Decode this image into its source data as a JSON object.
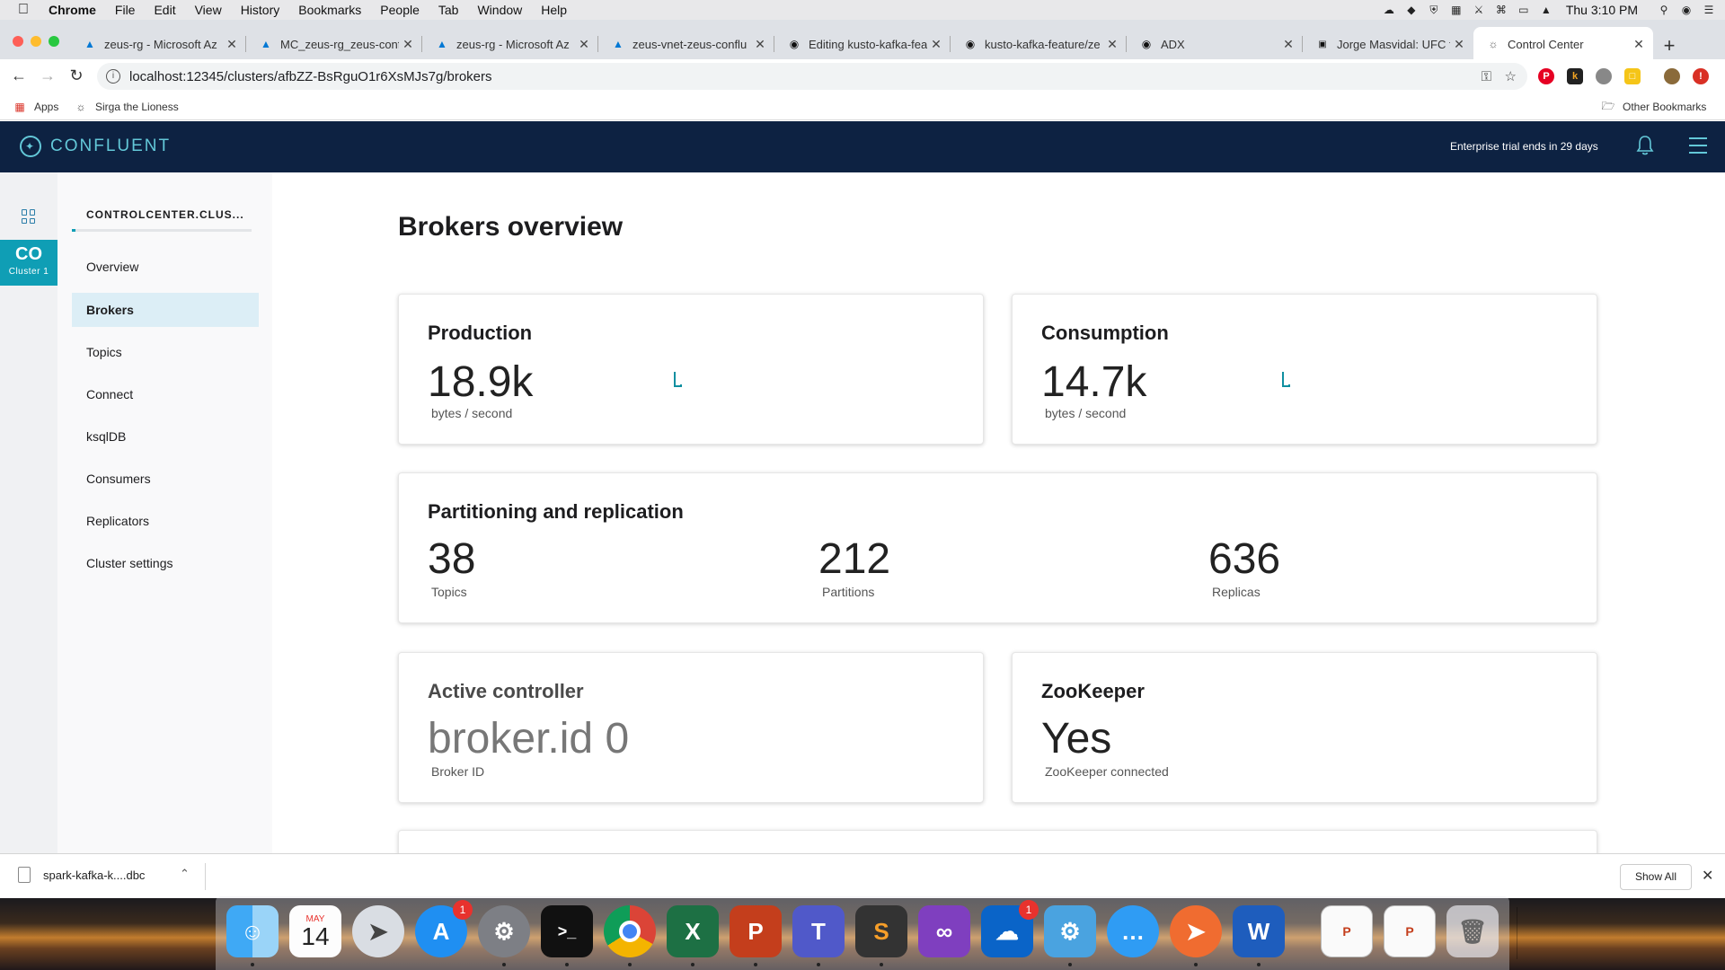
{
  "menubar": {
    "app": "Chrome",
    "items": [
      "File",
      "Edit",
      "View",
      "History",
      "Bookmarks",
      "People",
      "Tab",
      "Window",
      "Help"
    ],
    "clock": "Thu 3:10 PM"
  },
  "tabs": [
    {
      "title": "zeus-rg - Microsoft Az",
      "icon": "azure-icon"
    },
    {
      "title": "MC_zeus-rg_zeus-conf",
      "icon": "azure-icon"
    },
    {
      "title": "zeus-rg - Microsoft Az",
      "icon": "azure-icon"
    },
    {
      "title": "zeus-vnet-zeus-conflu",
      "icon": "azure-icon"
    },
    {
      "title": "Editing kusto-kafka-fea",
      "icon": "github-icon"
    },
    {
      "title": "kusto-kafka-feature/ze",
      "icon": "github-icon"
    },
    {
      "title": "ADX",
      "icon": "github-icon"
    },
    {
      "title": "Jorge Masvidal: UFC fi",
      "icon": "news-icon"
    },
    {
      "title": "Control Center",
      "icon": "globe-icon"
    }
  ],
  "toolbar": {
    "url": "localhost:12345/clusters/afbZZ-BsRguO1r6XsMJs7g/brokers"
  },
  "bookmarks": {
    "apps": "Apps",
    "item1": "Sirga the Lioness",
    "other": "Other Bookmarks"
  },
  "header": {
    "brand": "CONFLUENT",
    "trial": "Enterprise trial ends in 29 days",
    "accent": "#63c8d8",
    "background": "#0d2242"
  },
  "rail": {
    "cluster_code": "CO",
    "cluster_name": "Cluster 1"
  },
  "sidebar": {
    "cluster_title": "CONTROLCENTER.CLUS...",
    "items": [
      {
        "label": "Overview"
      },
      {
        "label": "Brokers",
        "active": true
      },
      {
        "label": "Topics"
      },
      {
        "label": "Connect"
      },
      {
        "label": "ksqlDB"
      },
      {
        "label": "Consumers"
      },
      {
        "label": "Replicators"
      },
      {
        "label": "Cluster settings"
      }
    ]
  },
  "main": {
    "title": "Brokers overview",
    "production": {
      "title": "Production",
      "value": "18.9k",
      "unit": "bytes / second"
    },
    "consumption": {
      "title": "Consumption",
      "value": "14.7k",
      "unit": "bytes / second"
    },
    "partitioning": {
      "title": "Partitioning and replication",
      "topics": {
        "value": "38",
        "label": "Topics"
      },
      "partitions": {
        "value": "212",
        "label": "Partitions"
      },
      "replicas": {
        "value": "636",
        "label": "Replicas"
      }
    },
    "controller": {
      "title": "Active controller",
      "value": "broker.id 0",
      "unit": "Broker ID"
    },
    "zookeeper": {
      "title": "ZooKeeper",
      "value": "Yes",
      "unit": "ZooKeeper connected"
    }
  },
  "download": {
    "file": "spark-kafka-k....dbc",
    "show_all": "Show All"
  },
  "dock": {
    "calendar_month": "MAY",
    "calendar_day": "14",
    "appstore_badge": "1",
    "onedrive_badge": "1"
  }
}
